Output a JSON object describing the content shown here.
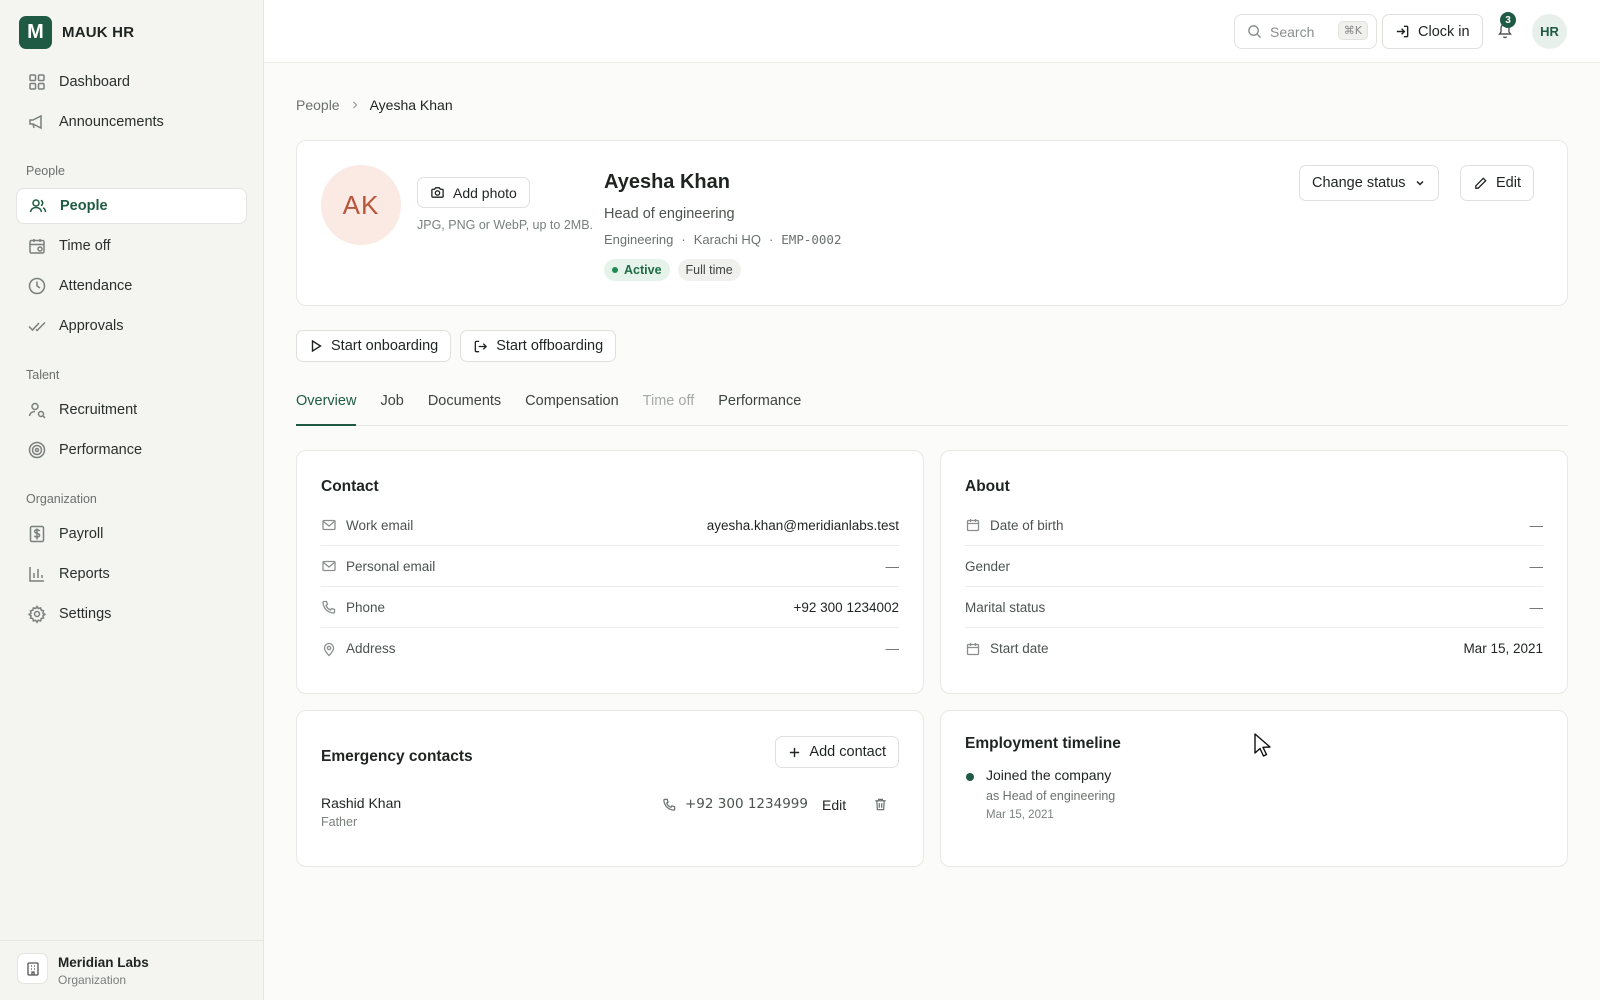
{
  "brand": {
    "logo_letter": "M",
    "name": "MAUK HR"
  },
  "sidebar": {
    "top_items": [
      {
        "label": "Dashboard",
        "icon": "grid-icon"
      },
      {
        "label": "Announcements",
        "icon": "megaphone-icon"
      }
    ],
    "sections": [
      {
        "title": "People",
        "items": [
          {
            "label": "People",
            "icon": "users-icon",
            "active": true
          },
          {
            "label": "Time off",
            "icon": "calendar-icon"
          },
          {
            "label": "Attendance",
            "icon": "clock-icon"
          },
          {
            "label": "Approvals",
            "icon": "double-check-icon"
          }
        ]
      },
      {
        "title": "Talent",
        "items": [
          {
            "label": "Recruitment",
            "icon": "user-search-icon"
          },
          {
            "label": "Performance",
            "icon": "target-icon"
          }
        ]
      },
      {
        "title": "Organization",
        "items": [
          {
            "label": "Payroll",
            "icon": "dollar-file-icon"
          },
          {
            "label": "Reports",
            "icon": "bar-chart-icon"
          },
          {
            "label": "Settings",
            "icon": "gear-icon"
          }
        ]
      }
    ],
    "org": {
      "name": "Meridian Labs",
      "subtitle": "Organization"
    }
  },
  "topbar": {
    "search_placeholder": "Search",
    "search_shortcut": "⌘K",
    "clock_in_label": "Clock in",
    "notification_count": "3",
    "user_initials": "HR"
  },
  "breadcrumb": {
    "parent": "People",
    "current": "Ayesha Khan"
  },
  "profile": {
    "initials": "AK",
    "add_photo_label": "Add photo",
    "photo_hint": "JPG, PNG or WebP, up to 2MB.",
    "name": "Ayesha Khan",
    "title": "Head of engineering",
    "department": "Engineering",
    "location": "Karachi HQ",
    "employee_id": "EMP-0002",
    "status": "Active",
    "employment_type": "Full time",
    "change_status_label": "Change status",
    "edit_label": "Edit"
  },
  "actions": {
    "start_onboarding": "Start onboarding",
    "start_offboarding": "Start offboarding"
  },
  "tabs": [
    {
      "label": "Overview",
      "active": true
    },
    {
      "label": "Job"
    },
    {
      "label": "Documents"
    },
    {
      "label": "Compensation"
    },
    {
      "label": "Time off",
      "disabled": true
    },
    {
      "label": "Performance"
    }
  ],
  "contact": {
    "title": "Contact",
    "rows": [
      {
        "label": "Work email",
        "value": "ayesha.khan@meridianlabs.test",
        "icon": "mail-icon"
      },
      {
        "label": "Personal email",
        "value": "—",
        "icon": "mail-icon"
      },
      {
        "label": "Phone",
        "value": "+92 300 1234002",
        "icon": "phone-icon"
      },
      {
        "label": "Address",
        "value": "—",
        "icon": "map-pin-icon"
      }
    ]
  },
  "about": {
    "title": "About",
    "rows": [
      {
        "label": "Date of birth",
        "value": "—",
        "icon": "calendar-icon"
      },
      {
        "label": "Gender",
        "value": "—"
      },
      {
        "label": "Marital status",
        "value": "—"
      },
      {
        "label": "Start date",
        "value": "Mar 15, 2021",
        "icon": "calendar-icon"
      }
    ]
  },
  "emergency": {
    "title": "Emergency contacts",
    "add_label": "Add contact",
    "contacts": [
      {
        "name": "Rashid Khan",
        "relation": "Father",
        "phone": "+92 300 1234999",
        "edit_label": "Edit"
      }
    ]
  },
  "timeline": {
    "title": "Employment timeline",
    "events": [
      {
        "event": "Joined the company",
        "detail": "as Head of engineering",
        "date": "Mar 15, 2021"
      }
    ]
  },
  "colors": {
    "accent": "#1f5a44",
    "active_badge": "#1f8a4f",
    "avatar_bg": "#fbe9e4",
    "avatar_text": "#b9553a"
  }
}
